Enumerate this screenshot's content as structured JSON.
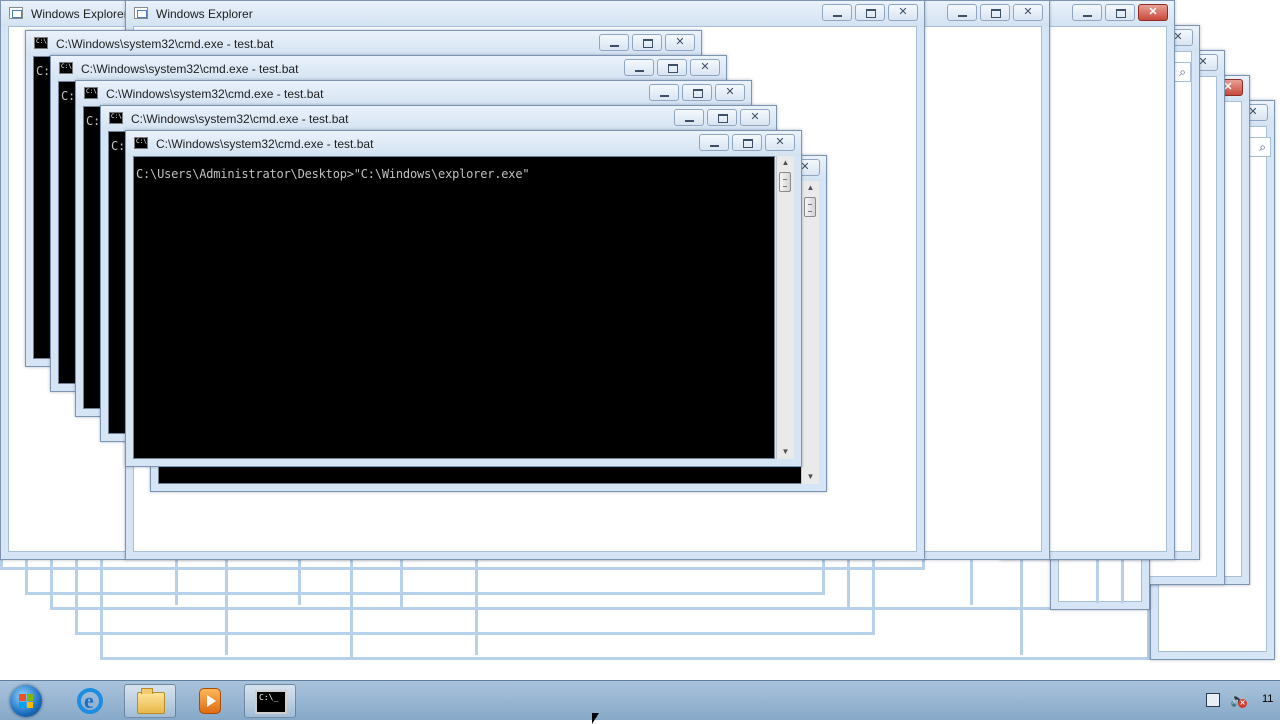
{
  "windows": {
    "explorer_back": {
      "title": "Windows Explorer"
    },
    "explorer_front": {
      "title": "Windows Explorer"
    },
    "cmd": [
      {
        "title": "C:\\Windows\\system32\\cmd.exe - test.bat"
      },
      {
        "title": "C:\\Windows\\system32\\cmd.exe - test.bat"
      },
      {
        "title": "C:\\Windows\\system32\\cmd.exe - test.bat"
      },
      {
        "title": "C:\\Windows\\system32\\cmd.exe - test.bat"
      },
      {
        "title": "C:\\Windows\\system32\\cmd.exe - test.bat"
      }
    ],
    "console": {
      "prompt_line": "C:\\Users\\Administrator\\Desktop>\"C:\\Windows\\explorer.exe\"",
      "partial_prompt": "C:"
    }
  },
  "icons": {
    "minimize": "minimize-icon",
    "maximize": "maximize-icon",
    "close": "close-icon",
    "search": "search-icon"
  },
  "colors": {
    "close_active": "#c74a3b",
    "frame_border": "#b7d1ea",
    "console_bg": "#000000",
    "console_fg": "#c0c0c0",
    "taskbar": "#9bb8d4"
  },
  "taskbar": {
    "clock_partial": "11"
  }
}
